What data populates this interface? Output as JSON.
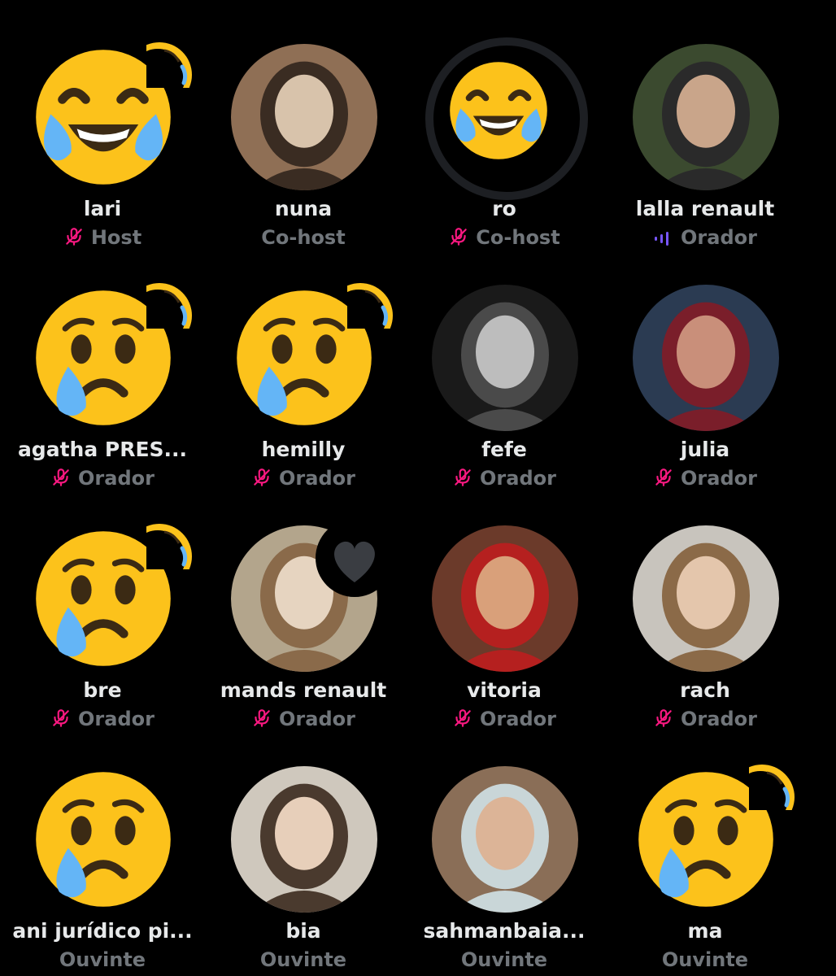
{
  "roles": {
    "host": "Host",
    "cohost": "Co-host",
    "speaker": "Orador",
    "listener": "Ouvinte"
  },
  "colors": {
    "background": "#000000",
    "name_text": "#e7e9ea",
    "role_text": "#71767b",
    "muted_icon": "#f91880",
    "speaking_icon": "#7856ff",
    "emoji_yellow": "#fcc21b",
    "tear_blue": "#64b5f6"
  },
  "participants": [
    {
      "name": "lari",
      "role": "Host",
      "status": "muted",
      "avatar": "tears-of-joy-emoji",
      "badge": "partial-emoji"
    },
    {
      "name": "nuna",
      "role": "Co-host",
      "status": "none",
      "avatar": "photo",
      "badge": ""
    },
    {
      "name": "ro",
      "role": "Co-host",
      "status": "muted",
      "avatar": "tears-of-joy-emoji",
      "badge": ""
    },
    {
      "name": "lalla renault",
      "role": "Orador",
      "status": "speaking",
      "avatar": "photo",
      "badge": ""
    },
    {
      "name": "agatha PRES...",
      "role": "Orador",
      "status": "muted",
      "avatar": "crying-face-emoji",
      "badge": "partial-emoji"
    },
    {
      "name": "hemilly",
      "role": "Orador",
      "status": "muted",
      "avatar": "crying-face-emoji",
      "badge": "partial-emoji"
    },
    {
      "name": "fefe",
      "role": "Orador",
      "status": "muted",
      "avatar": "photo",
      "badge": ""
    },
    {
      "name": "julia",
      "role": "Orador",
      "status": "muted",
      "avatar": "photo",
      "badge": ""
    },
    {
      "name": "bre",
      "role": "Orador",
      "status": "muted",
      "avatar": "crying-face-emoji",
      "badge": "partial-emoji"
    },
    {
      "name": "mands renault",
      "role": "Orador",
      "status": "muted",
      "avatar": "photo",
      "badge": "heart-icon"
    },
    {
      "name": "vitoria",
      "role": "Orador",
      "status": "muted",
      "avatar": "photo",
      "badge": ""
    },
    {
      "name": "rach",
      "role": "Orador",
      "status": "muted",
      "avatar": "photo",
      "badge": ""
    },
    {
      "name": "ani jurídico pi...",
      "role": "Ouvinte",
      "status": "none",
      "avatar": "crying-face-emoji",
      "badge": ""
    },
    {
      "name": "bia",
      "role": "Ouvinte",
      "status": "none",
      "avatar": "photo",
      "badge": ""
    },
    {
      "name": "sahmanbaia...",
      "role": "Ouvinte",
      "status": "none",
      "avatar": "photo",
      "badge": ""
    },
    {
      "name": "ma",
      "role": "Ouvinte",
      "status": "none",
      "avatar": "crying-face-emoji",
      "badge": "partial-emoji"
    }
  ]
}
